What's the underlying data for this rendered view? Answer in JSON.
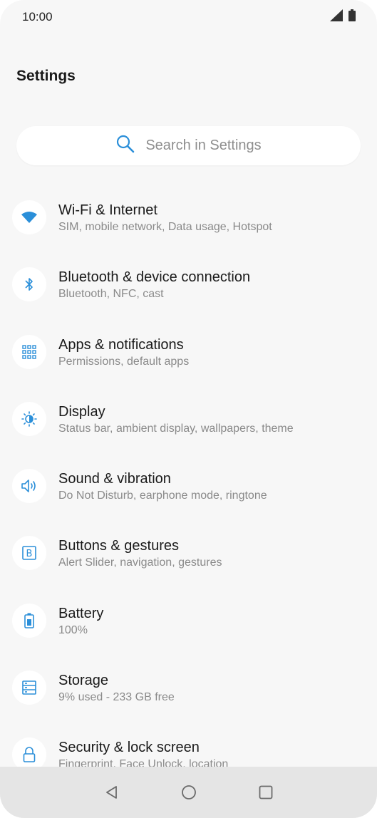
{
  "status_bar": {
    "time": "10:00",
    "icons": [
      "signal-icon",
      "battery-icon"
    ]
  },
  "header": {
    "title": "Settings"
  },
  "search": {
    "placeholder": "Search in Settings",
    "icon": "search-icon"
  },
  "accent_color": "#2b8fd9",
  "settings": {
    "items": [
      {
        "title": "Wi-Fi & Internet",
        "subtitle": "SIM, mobile network, Data usage, Hotspot",
        "icon": "wifi-icon"
      },
      {
        "title": "Bluetooth & device connection",
        "subtitle": "Bluetooth, NFC, cast",
        "icon": "bluetooth-icon"
      },
      {
        "title": "Apps & notifications",
        "subtitle": "Permissions, default apps",
        "icon": "apps-grid-icon"
      },
      {
        "title": "Display",
        "subtitle": "Status bar, ambient display, wallpapers, theme",
        "icon": "brightness-icon"
      },
      {
        "title": "Sound & vibration",
        "subtitle": "Do Not Disturb, earphone mode, ringtone",
        "icon": "speaker-icon"
      },
      {
        "title": "Buttons & gestures",
        "subtitle": "Alert Slider, navigation, gestures",
        "icon": "buttons-icon"
      },
      {
        "title": "Battery",
        "subtitle": "100%",
        "icon": "battery-icon"
      },
      {
        "title": "Storage",
        "subtitle": "9% used - 233 GB free",
        "icon": "storage-icon"
      },
      {
        "title": "Security & lock screen",
        "subtitle": "Fingerprint, Face Unlock, location",
        "icon": "lock-icon"
      }
    ]
  },
  "navigation": {
    "icons": [
      "back-icon",
      "home-icon",
      "recents-icon"
    ]
  }
}
